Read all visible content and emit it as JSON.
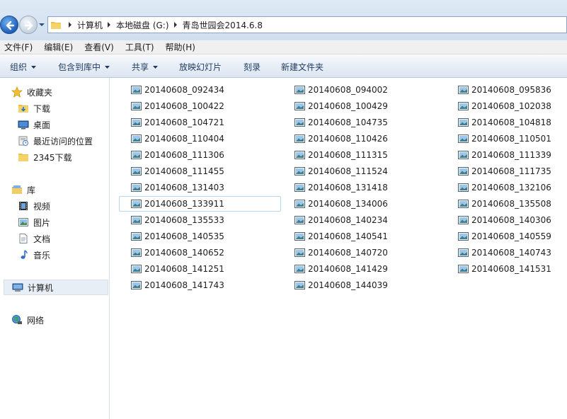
{
  "address_bar": {
    "crumbs": [
      "计算机",
      "本地磁盘 (G:)",
      "青岛世园会2014.6.8"
    ]
  },
  "menu": [
    "文件(F)",
    "编辑(E)",
    "查看(V)",
    "工具(T)",
    "帮助(H)"
  ],
  "toolbar": {
    "organize": "组织",
    "include_in_library": "包含到库中",
    "share": "共享",
    "slideshow": "放映幻灯片",
    "burn": "刻录",
    "new_folder": "新建文件夹"
  },
  "sidebar": {
    "favorites": {
      "label": "收藏夹",
      "items": [
        {
          "label": "下载",
          "icon": "downloads-folder-icon"
        },
        {
          "label": "桌面",
          "icon": "desktop-icon"
        },
        {
          "label": "最近访问的位置",
          "icon": "recent-places-icon"
        },
        {
          "label": "2345下载",
          "icon": "folder-icon"
        }
      ]
    },
    "libraries": {
      "label": "库",
      "items": [
        {
          "label": "视频",
          "icon": "video-library-icon"
        },
        {
          "label": "图片",
          "icon": "picture-library-icon"
        },
        {
          "label": "文档",
          "icon": "document-library-icon"
        },
        {
          "label": "音乐",
          "icon": "music-library-icon"
        }
      ]
    },
    "computer": {
      "label": "计算机"
    },
    "network": {
      "label": "网络"
    }
  },
  "files": {
    "columns": [
      [
        "20140608_092434",
        "20140608_100422",
        "20140608_104721",
        "20140608_110404",
        "20140608_111306",
        "20140608_111455",
        "20140608_131403",
        "20140608_133911",
        "20140608_135533",
        "20140608_140535",
        "20140608_140652",
        "20140608_141251",
        "20140608_141743"
      ],
      [
        "20140608_094002",
        "20140608_100429",
        "20140608_104735",
        "20140608_110426",
        "20140608_111315",
        "20140608_111524",
        "20140608_131418",
        "20140608_134006",
        "20140608_140234",
        "20140608_140541",
        "20140608_140720",
        "20140608_141429",
        "20140608_144039"
      ],
      [
        "20140608_095836",
        "20140608_102038",
        "20140608_104818",
        "20140608_110501",
        "20140608_111339",
        "20140608_111735",
        "20140608_132106",
        "20140608_135508",
        "20140608_140306",
        "20140608_140559",
        "20140608_140743",
        "20140608_141531"
      ]
    ],
    "focused": "20140608_133911"
  },
  "colors": {
    "accent": "#1f5fb8",
    "selection_bg": "#e8eef5",
    "toolbar_text": "#1e3a5f"
  }
}
